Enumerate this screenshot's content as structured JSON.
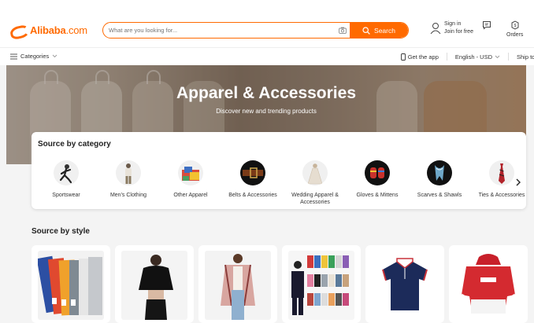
{
  "header": {
    "logo_main": "Alibaba",
    "logo_suffix": ".com",
    "search_placeholder": "What are you looking for...",
    "search_button": "Search",
    "signin_line1": "Sign in",
    "signin_line2": "Join for free",
    "orders_label": "Orders"
  },
  "subnav": {
    "categories_label": "Categories",
    "get_app": "Get the app",
    "locale": "English - USD",
    "ship_to": "Ship to"
  },
  "banner": {
    "title": "Apparel & Accessories",
    "subtitle": "Discover new and trending products"
  },
  "category_section": {
    "title": "Source by category",
    "items": [
      {
        "label": "Sportswear"
      },
      {
        "label": "Men's Clothing"
      },
      {
        "label": "Other Apparel"
      },
      {
        "label": "Belts & Accessories"
      },
      {
        "label": "Wedding Apparel & Accessories"
      },
      {
        "label": "Gloves & Mittens"
      },
      {
        "label": "Scarves & Shawls"
      },
      {
        "label": "Ties & Accessories"
      }
    ]
  },
  "style_section": {
    "title": "Source by style"
  },
  "colors": {
    "brand": "#ff6a00"
  }
}
